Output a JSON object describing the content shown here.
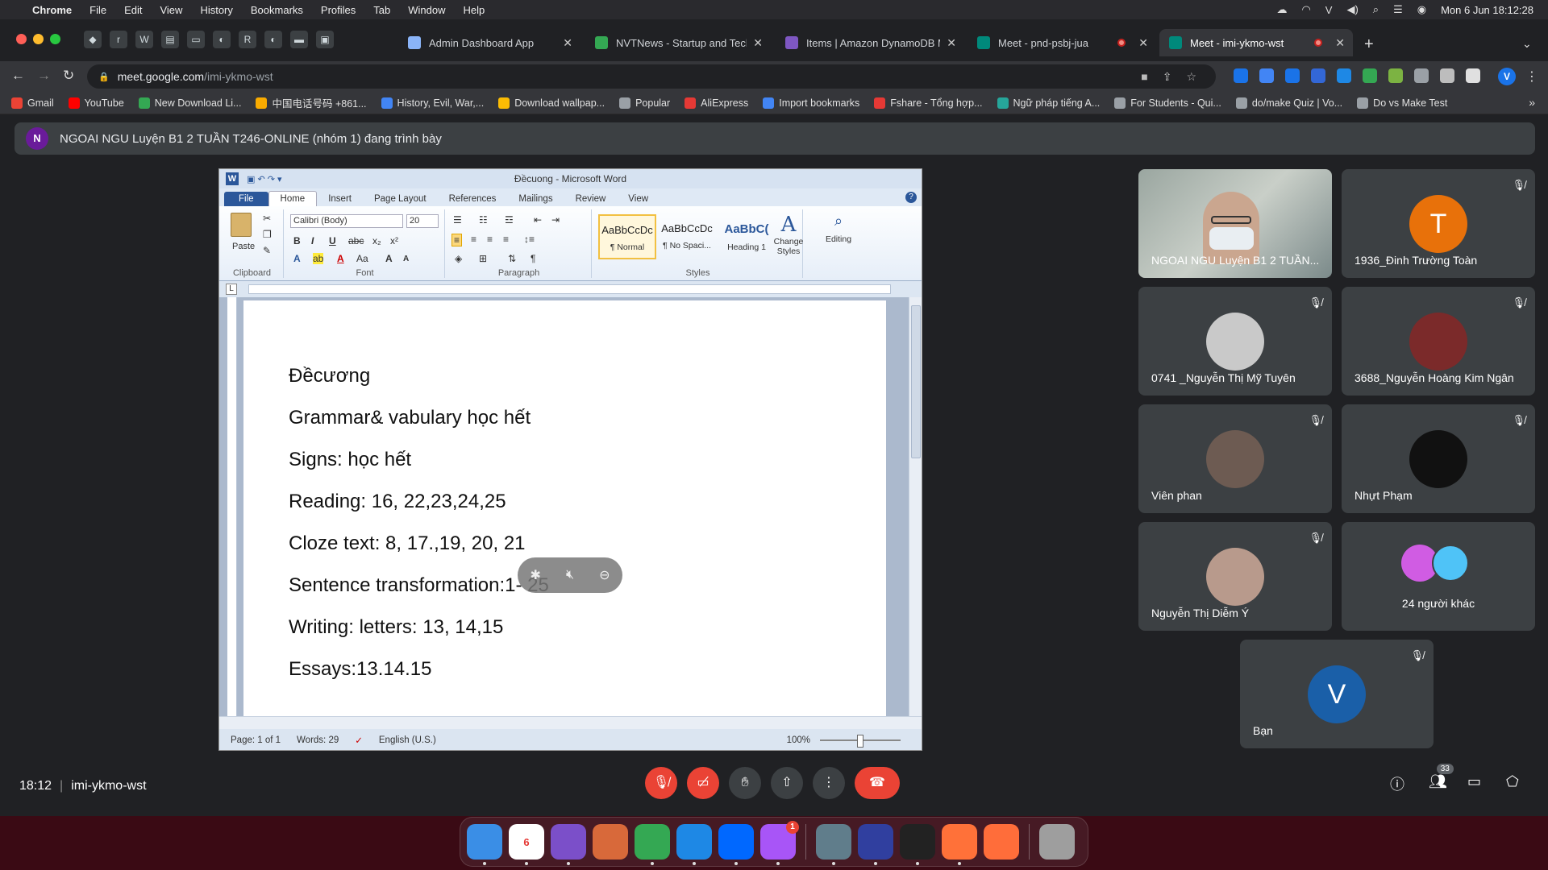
{
  "menubar": {
    "app": "Chrome",
    "items": [
      "File",
      "Edit",
      "View",
      "History",
      "Bookmarks",
      "Profiles",
      "Tab",
      "Window",
      "Help"
    ],
    "datetime": "Mon 6 Jun  18:12:28"
  },
  "tabs": [
    {
      "title": "Admin Dashboard App",
      "color": "#8ab4f8"
    },
    {
      "title": "NVTNews - Startup and Techn",
      "color": "#34a853"
    },
    {
      "title": "Items | Amazon DynamoDB Ma",
      "color": "#7e57c2"
    },
    {
      "title": "Meet - pnd-psbj-jua",
      "color": "#00897b"
    },
    {
      "title": "Meet - imi-ykmo-wst",
      "color": "#00897b"
    }
  ],
  "address": {
    "domain": "meet.google.com",
    "path": "/imi-ykmo-wst"
  },
  "bookmarks": [
    {
      "label": "Gmail",
      "color": "#ea4335"
    },
    {
      "label": "YouTube",
      "color": "#ff0000"
    },
    {
      "label": "New Download Li...",
      "color": "#34a853"
    },
    {
      "label": "中国电话号码 +861...",
      "color": "#f9ab00"
    },
    {
      "label": "History, Evil, War,...",
      "color": "#4285f4"
    },
    {
      "label": "Download wallpap...",
      "color": "#fbbc04"
    },
    {
      "label": "Popular",
      "color": "#9aa0a6"
    },
    {
      "label": "AliExpress",
      "color": "#e53935"
    },
    {
      "label": "Import bookmarks",
      "color": "#4285f4"
    },
    {
      "label": "Fshare - Tổng hợp...",
      "color": "#e53935"
    },
    {
      "label": "Ngữ pháp tiếng A...",
      "color": "#26a69a"
    },
    {
      "label": "For Students - Qui...",
      "color": "#9aa0a6"
    },
    {
      "label": "do/make Quiz | Vo...",
      "color": "#9aa0a6"
    },
    {
      "label": "Do vs Make Test",
      "color": "#9aa0a6"
    }
  ],
  "banner": {
    "initial": "N",
    "text": "NGOAI NGU Luyện B1 2 TUẦN T246-ONLINE (nhóm 1) đang trình bày"
  },
  "word": {
    "title": "Đềcuong - Microsoft Word",
    "ribbon_tabs": [
      "File",
      "Home",
      "Insert",
      "Page Layout",
      "References",
      "Mailings",
      "Review",
      "View"
    ],
    "font_name": "Calibri (Body)",
    "font_size": "20",
    "group_labels": {
      "clipboard": "Clipboard",
      "font": "Font",
      "paragraph": "Paragraph",
      "styles": "Styles"
    },
    "paste_label": "Paste",
    "styles": [
      {
        "sample": "AaBbCcDc",
        "name": "¶ Normal"
      },
      {
        "sample": "AaBbCcDc",
        "name": "¶ No Spaci..."
      },
      {
        "sample": "AaBbC(",
        "name": "Heading 1"
      }
    ],
    "change_styles": "Change Styles",
    "editing": "Editing",
    "doc_lines": [
      "Đềcương",
      "Grammar& vabulary học hết",
      "Signs:  học hết",
      "Reading: 16, 22,23,24,25",
      "Cloze text:  8, 17.,19, 20, 21",
      "Sentence transformation:1- 25",
      "Writing: letters: 13, 14,15",
      "Essays:13.14.15"
    ],
    "status": {
      "page": "Page: 1 of 1",
      "words": "Words: 29",
      "language": "English (U.S.)",
      "zoom": "100%"
    }
  },
  "participants": [
    {
      "name": "NGOAI NGU Luyện B1 2 TUẦN...",
      "type": "video"
    },
    {
      "name": "1936_Đinh Trường Toàn",
      "initial": "T",
      "color": "#e8710a",
      "muted": true
    },
    {
      "name": "0741 _Nguyễn Thị Mỹ Tuyên",
      "color": "#c9c9c9",
      "muted": true
    },
    {
      "name": "3688_Nguyễn Hoàng Kim Ngân",
      "color": "#7b2a2a",
      "muted": true
    },
    {
      "name": "Viên phan",
      "color": "#6d5b52",
      "muted": true
    },
    {
      "name": "Nhựt Phạm",
      "color": "#111111",
      "muted": true
    },
    {
      "name": "Nguyễn Thị Diễm Ý",
      "color": "#b89a8c",
      "muted": true
    },
    {
      "name": "24 người khác"
    },
    {
      "name": "Bạn",
      "initial": "V",
      "color": "#1a5fa8",
      "muted": true
    }
  ],
  "meeting": {
    "time": "18:12",
    "code": "imi-ykmo-wst",
    "people_count": "33"
  },
  "dock": [
    {
      "label": "Finder",
      "color": "#3a8ee6"
    },
    {
      "label": "6",
      "color": "#ffffff"
    },
    {
      "label": "VS",
      "color": "#7b4fc9"
    },
    {
      "label": "LP",
      "color": "#d8693a"
    },
    {
      "label": "Chrome",
      "color": "#34a853"
    },
    {
      "label": "Code",
      "color": "#1e88e5"
    },
    {
      "label": "Zalo",
      "color": "#0068ff"
    },
    {
      "label": "Msg",
      "color": "#a855f7"
    },
    {
      "label": "Img",
      "color": "#607d8b"
    },
    {
      "label": "Code",
      "color": "#303f9f"
    },
    {
      "label": "GH",
      "color": "#222222"
    },
    {
      "label": "FF",
      "color": "#ff7139"
    },
    {
      "label": "Pen",
      "color": "#ff6d3a"
    },
    {
      "label": "Trash",
      "color": "#9e9e9e"
    }
  ]
}
